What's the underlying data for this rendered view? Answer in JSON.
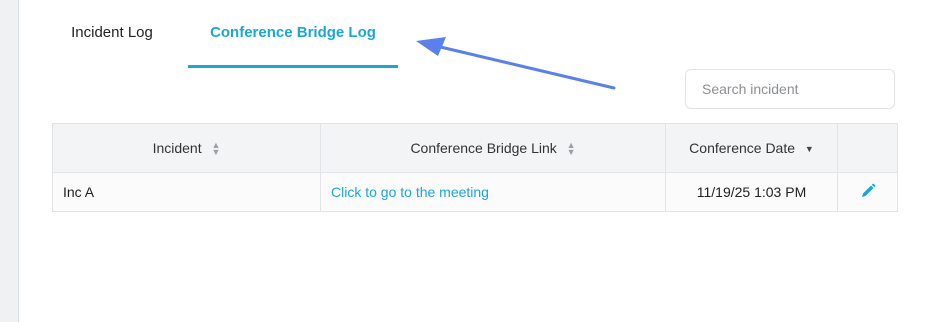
{
  "tabs": {
    "incident_log": "Incident Log",
    "conference_bridge_log": "Conference Bridge Log"
  },
  "search": {
    "placeholder": "Search incident"
  },
  "table": {
    "headers": {
      "incident": "Incident",
      "link": "Conference Bridge Link",
      "date": "Conference Date"
    },
    "rows": [
      {
        "incident": "Inc A",
        "link": "Click to go to the meeting",
        "date": "11/19/25 1:03 PM",
        "action_icon": "pencil-icon"
      }
    ]
  },
  "colors": {
    "accent": "#1aa7d8",
    "annotation_arrow": "#5b80ee"
  }
}
